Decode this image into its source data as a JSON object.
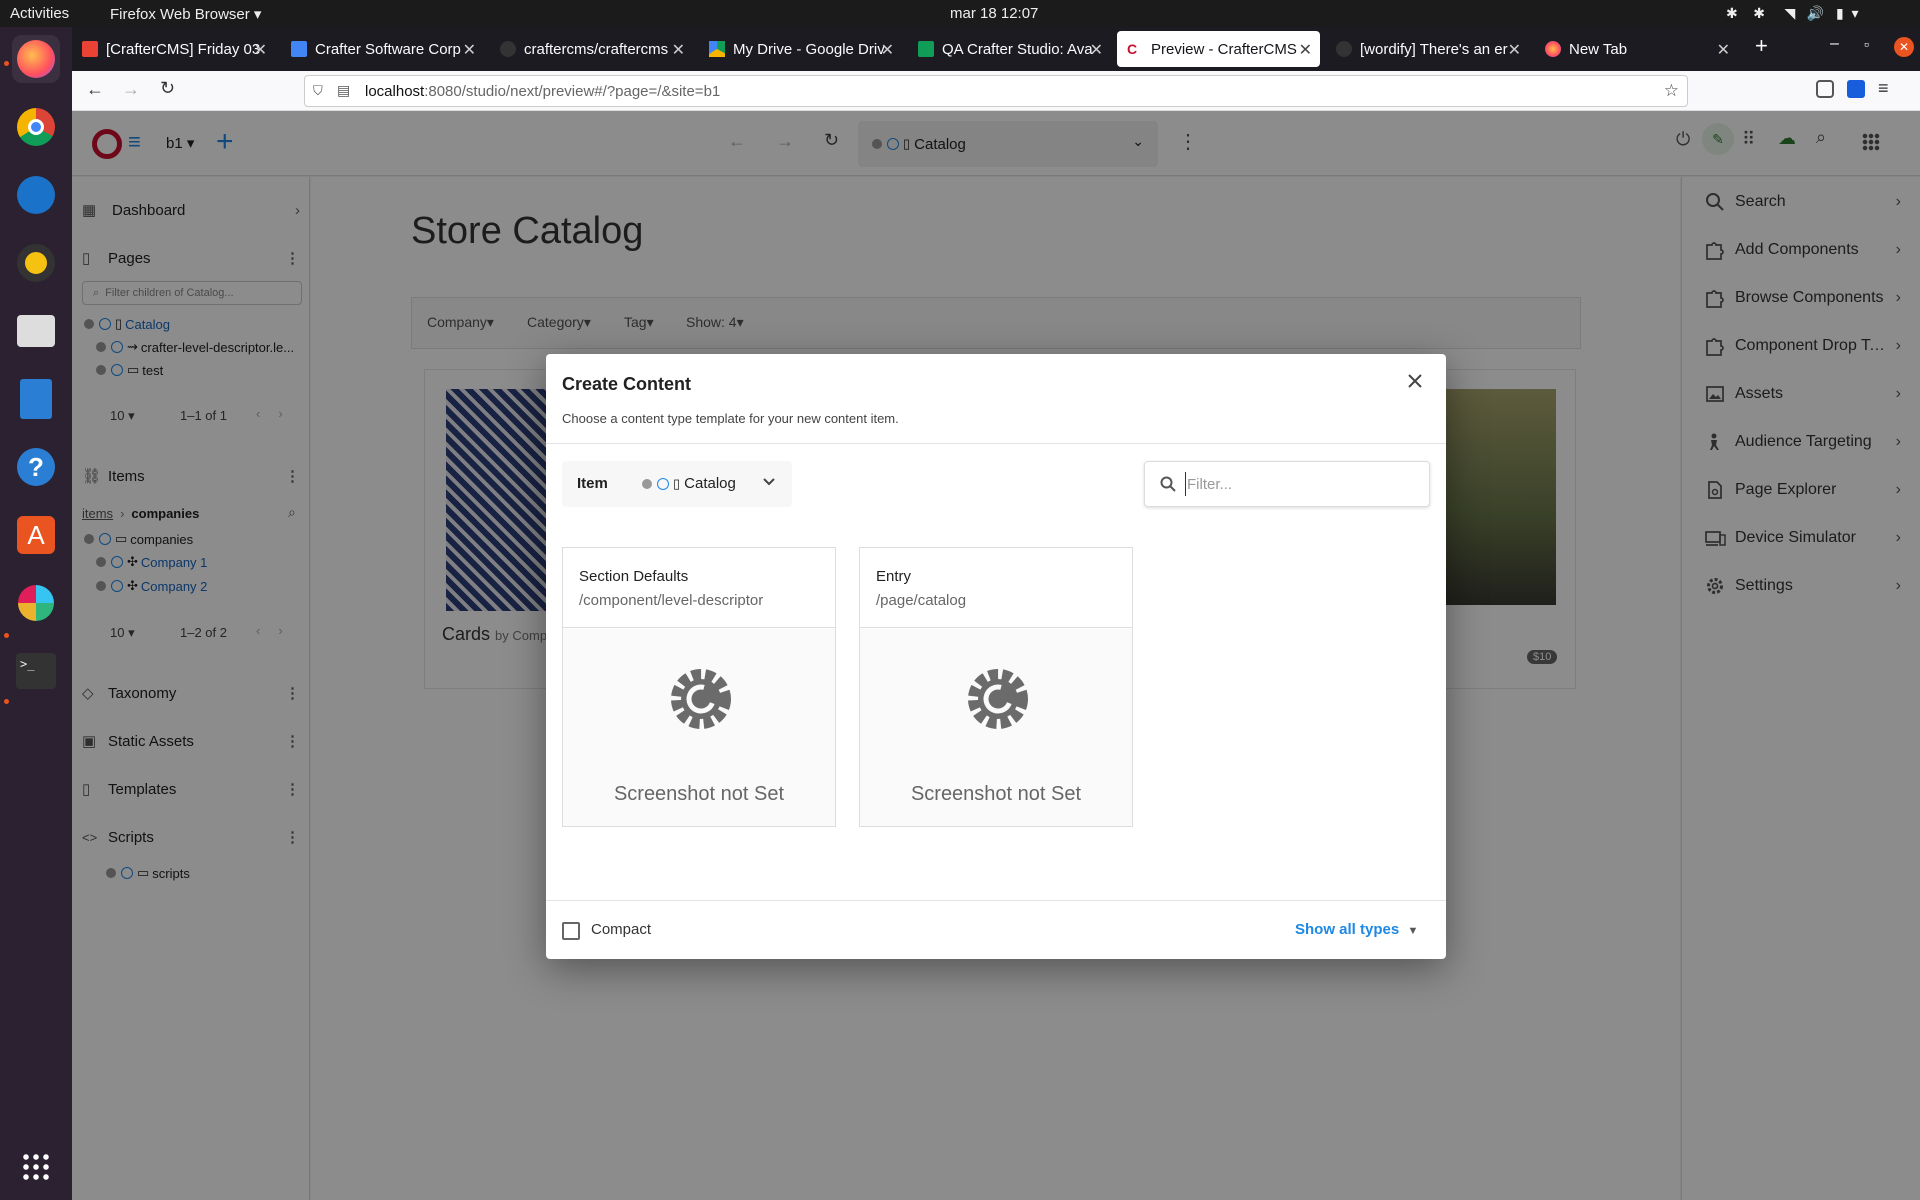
{
  "system_bar": {
    "activities": "Activities",
    "app_menu": "Firefox Web Browser",
    "clock": "mar 18  12:07"
  },
  "browser": {
    "tabs": [
      {
        "label": "[CrafterCMS] Friday 03"
      },
      {
        "label": "Crafter Software Corp"
      },
      {
        "label": "craftercms/craftercms"
      },
      {
        "label": "My Drive - Google Driv"
      },
      {
        "label": "QA Crafter Studio: Ava"
      },
      {
        "label": "Preview - CrafterCMS"
      },
      {
        "label": "[wordify] There's an er"
      },
      {
        "label": "New Tab"
      }
    ],
    "url_host": "localhost",
    "url_rest": ":8080/studio/next/preview#/?page=/&site=b1"
  },
  "studio": {
    "site": "b1",
    "address_bar_label": "Catalog",
    "left_nav": {
      "dashboard": "Dashboard",
      "pages": "Pages",
      "pages_filter_placeholder": "Filter children of Catalog...",
      "pages_tree": [
        "Catalog",
        "crafter-level-descriptor.le...",
        "test"
      ],
      "pages_per_page": "10",
      "pages_range": "1–1 of 1",
      "items": "Items",
      "items_breadcrumb_root": "items",
      "items_breadcrumb_current": "companies",
      "items_tree": [
        "companies",
        "Company 1",
        "Company 2"
      ],
      "items_per_page": "10",
      "items_range": "1–2 of 2",
      "taxonomy": "Taxonomy",
      "static_assets": "Static Assets",
      "templates": "Templates",
      "scripts": "Scripts",
      "scripts_tree": [
        "scripts"
      ]
    },
    "right_nav": [
      {
        "label": "Search",
        "icon": "search-icon"
      },
      {
        "label": "Add Components",
        "icon": "puzzle-icon"
      },
      {
        "label": "Browse Components",
        "icon": "puzzle-icon"
      },
      {
        "label": "Component Drop Ta...",
        "icon": "puzzle-icon"
      },
      {
        "label": "Assets",
        "icon": "image-icon"
      },
      {
        "label": "Audience Targeting",
        "icon": "person-icon"
      },
      {
        "label": "Page Explorer",
        "icon": "page-icon"
      },
      {
        "label": "Device Simulator",
        "icon": "devices-icon"
      },
      {
        "label": "Settings",
        "icon": "gear-icon"
      }
    ]
  },
  "preview": {
    "title": "Store Catalog",
    "filters": [
      "Company",
      "Category",
      "Tag",
      "Show: 4"
    ],
    "card_caption": "Cards",
    "card_by": "by Comp",
    "price_badge": "$10"
  },
  "dialog": {
    "title": "Create Content",
    "subtitle": "Choose a content type template for your new content item.",
    "item_label": "Item",
    "item_value": "Catalog",
    "filter_placeholder": "Filter...",
    "cards": [
      {
        "title": "Section Defaults",
        "path": "/component/level-descriptor",
        "screenshot_text": "Screenshot not Set"
      },
      {
        "title": "Entry",
        "path": "/page/catalog",
        "screenshot_text": "Screenshot not Set"
      }
    ],
    "compact_label": "Compact",
    "show_all_types": "Show all types"
  },
  "colors": {
    "accent": "#1e88e5",
    "brand": "#c8102e",
    "ubuntu_orange": "#e95420"
  }
}
